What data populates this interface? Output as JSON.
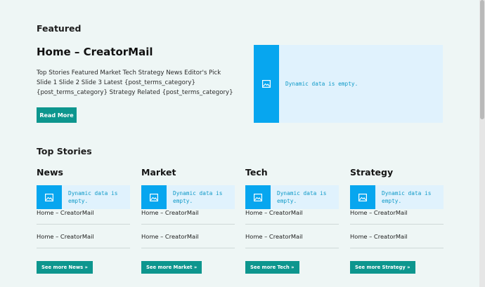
{
  "featured": {
    "section_title": "Featured",
    "title": "Home – CreatorMail",
    "excerpt": "Top Stories Featured Market Tech Strategy News Editor's Pick Slide 1 Slide 2 Slide 3 Latest {post_terms_category} {post_terms_category} Strategy Related {post_terms_category}",
    "read_more_label": "Read More",
    "image_placeholder": "Dynamic data is empty."
  },
  "top_stories": {
    "section_title": "Top Stories",
    "columns": [
      {
        "title": "News",
        "placeholder": "Dynamic data is empty.",
        "posts": [
          "Home – CreatorMail",
          "Home – CreatorMail"
        ],
        "see_more": "See more News »"
      },
      {
        "title": "Market",
        "placeholder": "Dynamic data is empty.",
        "posts": [
          "Home – CreatorMail",
          "Home – CreatorMail"
        ],
        "see_more": "See more Market »"
      },
      {
        "title": "Tech",
        "placeholder": "Dynamic data is empty.",
        "posts": [
          "Home – CreatorMail",
          "Home – CreatorMail"
        ],
        "see_more": "See more Tech »"
      },
      {
        "title": "Strategy",
        "placeholder": "Dynamic data is empty.",
        "posts": [
          "Home – CreatorMail",
          "Home – CreatorMail"
        ],
        "see_more": "See more Strategy »"
      }
    ]
  },
  "icons": {
    "placeholder_image": "image-icon"
  },
  "colors": {
    "accent": "#0d968e",
    "placeholder_bg": "#e0f2fd",
    "placeholder_icon_bg": "#07a6ef",
    "page_bg": "#eef6f5"
  }
}
